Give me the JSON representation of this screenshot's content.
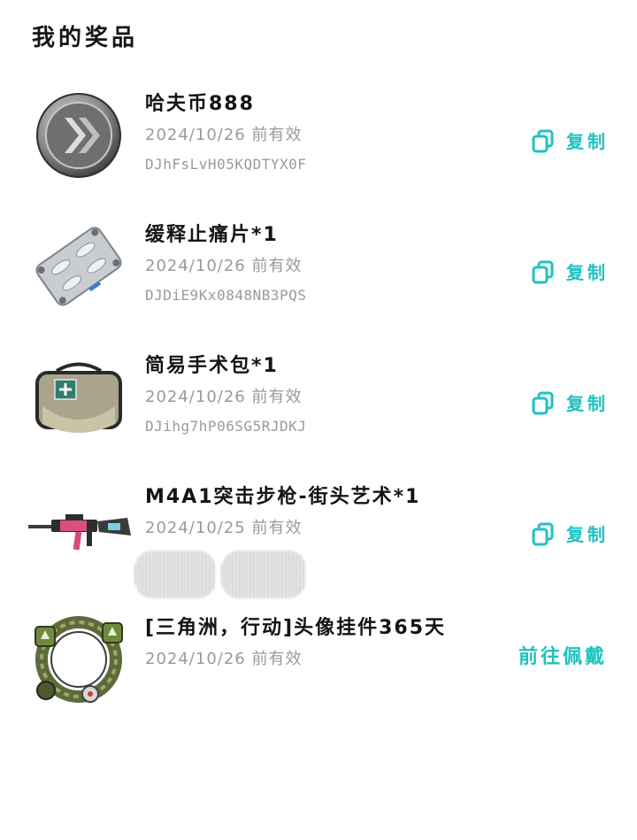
{
  "page_title": "我的奖品",
  "accent_color": "#1fc2c0",
  "prizes": [
    {
      "name": "哈夫币888",
      "expiry": "2024/10/26 前有效",
      "code": "DJhFsLvH05KQDTYX0F",
      "action_label": "复制",
      "icon": "coin-icon"
    },
    {
      "name": "缓释止痛片*1",
      "expiry": "2024/10/26 前有效",
      "code": "DJDiE9Kx0848NB3PQS",
      "action_label": "复制",
      "icon": "pill-pack-icon"
    },
    {
      "name": "简易手术包*1",
      "expiry": "2024/10/26 前有效",
      "code": "DJihg7hP06SG5RJDKJ",
      "action_label": "复制",
      "icon": "surgery-kit-icon"
    },
    {
      "name": "M4A1突击步枪-街头艺术*1",
      "expiry": "2024/10/25 前有效",
      "code": "",
      "action_label": "复制",
      "icon": "rifle-icon"
    },
    {
      "name": "[三角洲，行动]头像挂件365天",
      "expiry": "2024/10/26 前有效",
      "action_label": "前往佩戴",
      "icon": "avatar-frame-icon"
    }
  ]
}
